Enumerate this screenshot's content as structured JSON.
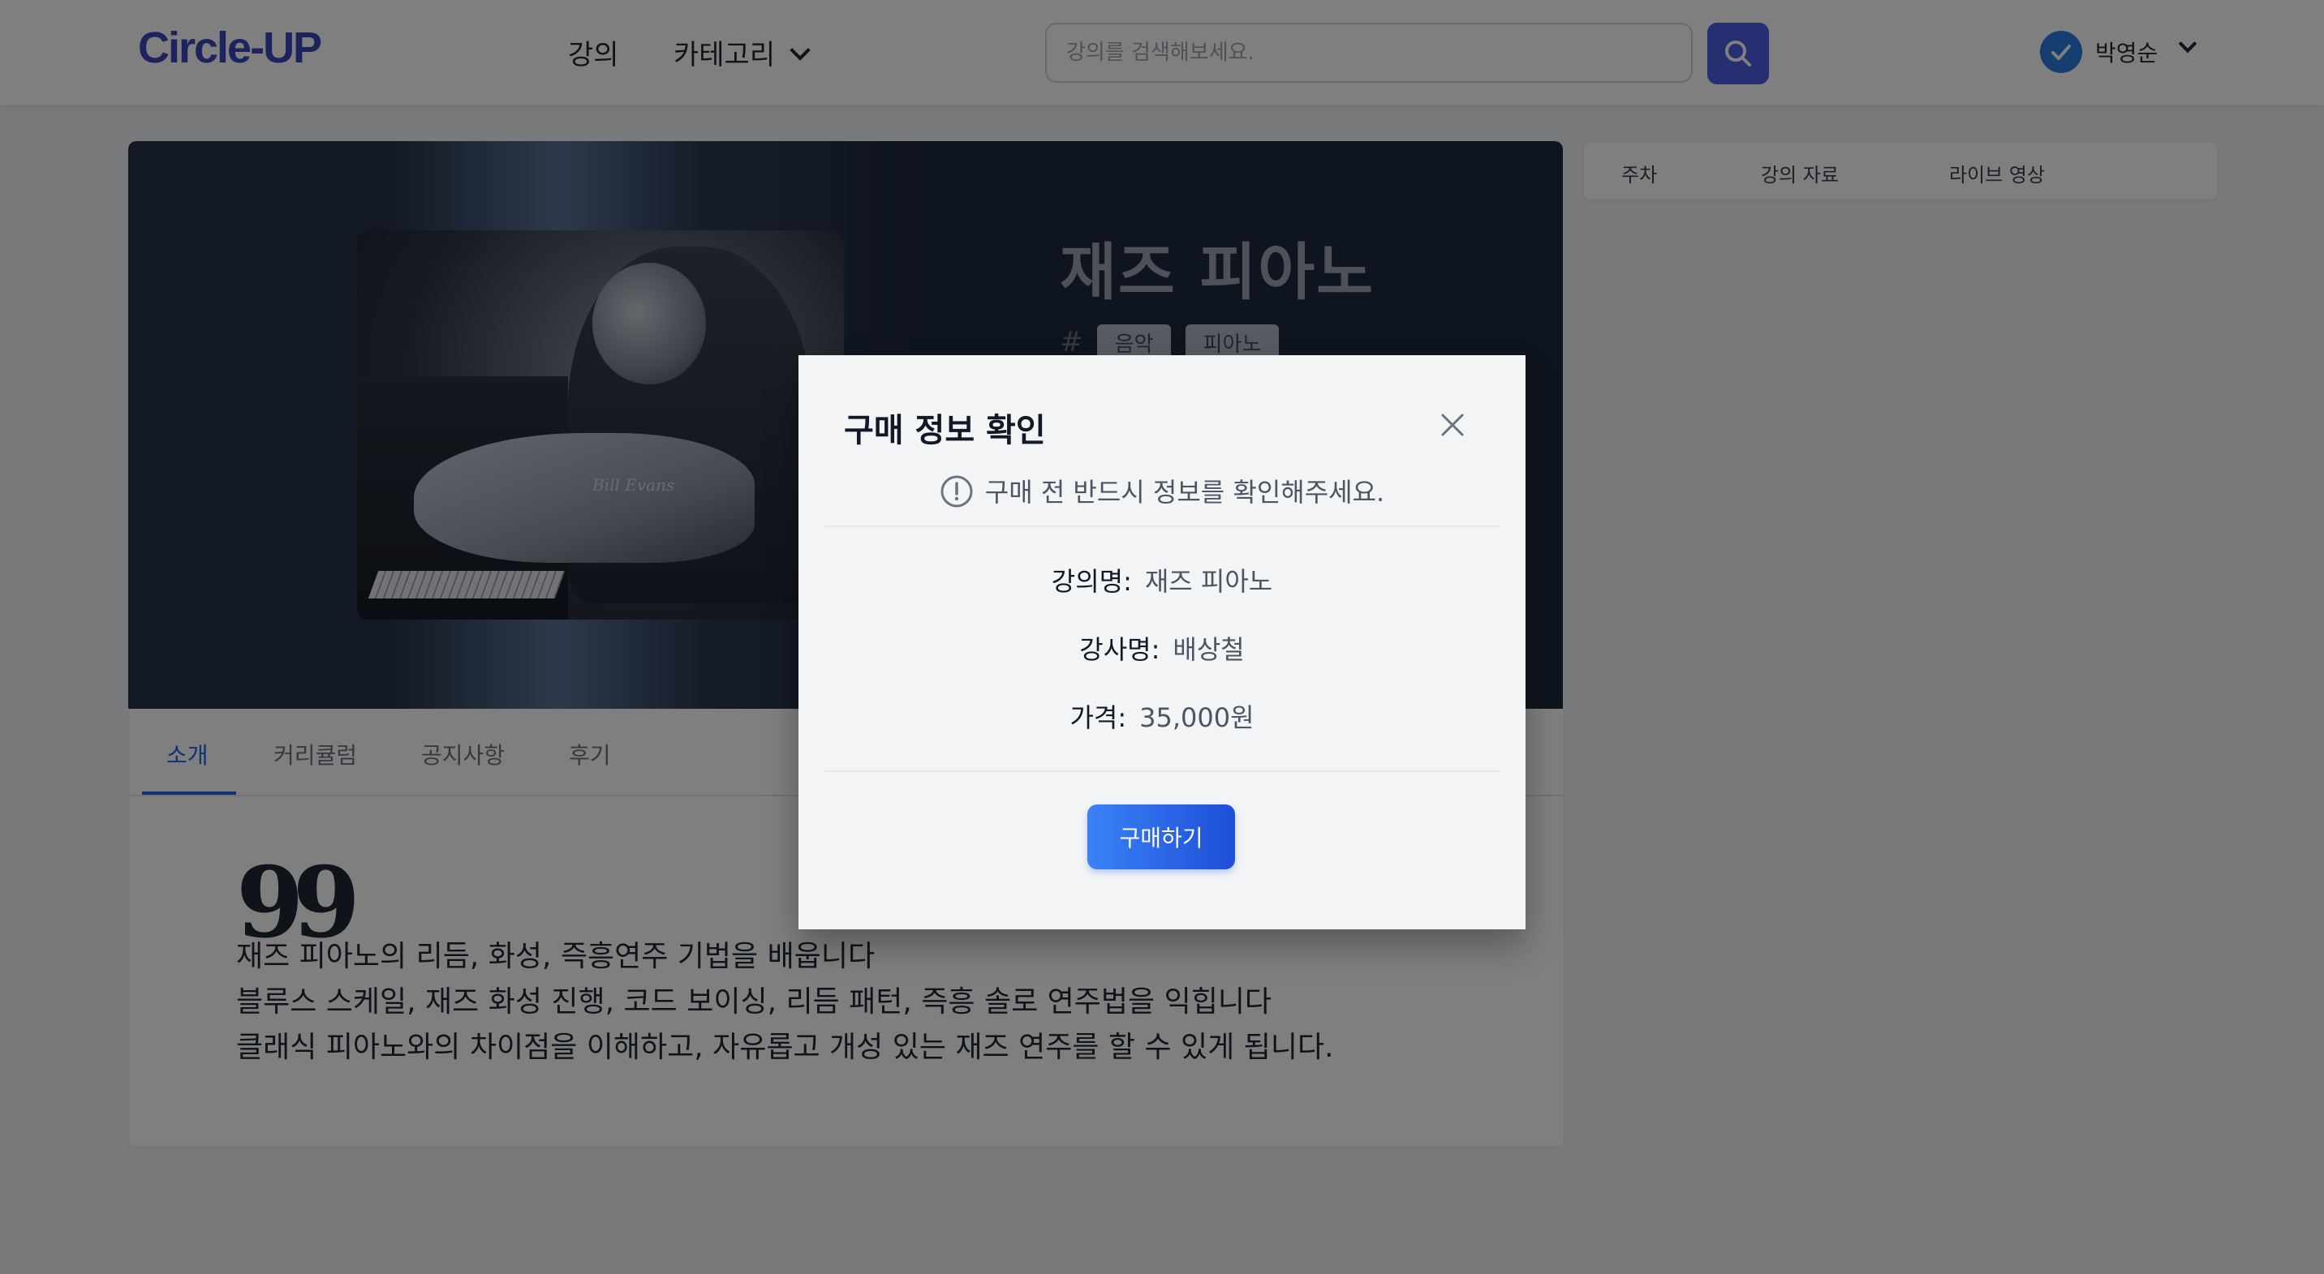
{
  "header": {
    "logo": "Circle-UP",
    "nav": {
      "lecture": "강의",
      "category": "카테고리"
    },
    "search": {
      "placeholder": "강의를 검색해보세요."
    },
    "user": {
      "name": "박영순"
    }
  },
  "hero": {
    "title": "재즈 피아노",
    "hash": "#",
    "tags": [
      "음악",
      "피아노"
    ],
    "image_caption": "Bill Evans"
  },
  "tabs": [
    "소개",
    "커리큘럼",
    "공지사항",
    "후기"
  ],
  "intro": {
    "quote_mark": "99",
    "lines": [
      "재즈 피아노의 리듬, 화성, 즉흥연주 기법을 배웁니다",
      "블루스 스케일, 재즈 화성 진행, 코드 보이싱, 리듬 패턴, 즉흥 솔로 연주법을 익힙니다",
      "클래식 피아노와의 차이점을 이해하고, 자유롭고 개성 있는 재즈 연주를 할 수 있게 됩니다."
    ]
  },
  "side_panel": {
    "tabs": [
      "주차",
      "강의 자료",
      "라이브 영상"
    ]
  },
  "modal": {
    "title": "구매 정보 확인",
    "notice": "구매 전 반드시 정보를 확인해주세요.",
    "rows": [
      {
        "label": "강의명:",
        "value": "재즈 피아노"
      },
      {
        "label": "강사명:",
        "value": "배상철"
      },
      {
        "label": "가격:",
        "value": "35,000원"
      }
    ],
    "buy_label": "구매하기"
  },
  "colors": {
    "brand": "#3b46b8",
    "primary": "#2563eb",
    "search_button": "#4f5fe6",
    "user_badge": "#2f7de1"
  },
  "icons": [
    "search-icon",
    "check-icon",
    "chevron-down-icon",
    "close-icon",
    "alert-circle-icon",
    "quote-icon"
  ]
}
